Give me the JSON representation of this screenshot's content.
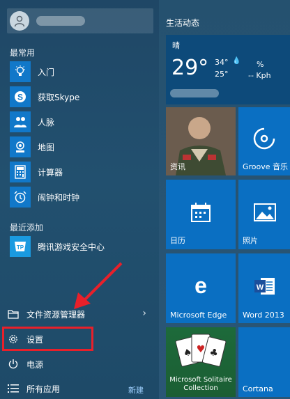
{
  "start_menu": {
    "most_used_label": "最常用",
    "most_used_apps": [
      {
        "label": "入门",
        "icon": "lightbulb-icon"
      },
      {
        "label": "获取Skype",
        "icon": "skype-icon"
      },
      {
        "label": "人脉",
        "icon": "people-icon"
      },
      {
        "label": "地图",
        "icon": "map-icon"
      },
      {
        "label": "计算器",
        "icon": "calculator-icon"
      },
      {
        "label": "闹钟和时钟",
        "icon": "alarm-clock-icon"
      }
    ],
    "recently_added_label": "最近添加",
    "recently_added_apps": [
      {
        "label": "腾讯游戏安全中心",
        "icon": "tencent-game-security-icon"
      }
    ],
    "system_items": {
      "file_explorer": "文件资源管理器",
      "settings": "设置",
      "power": "电源",
      "all_apps": "所有应用",
      "new_badge": "新建"
    }
  },
  "tiles": {
    "group_title": "生活动态",
    "weather": {
      "condition": "晴",
      "temperature": "29°",
      "high": "34°",
      "low": "25°",
      "humidity_label": "%",
      "wind_label": "-- Kph"
    },
    "news_label": "资讯",
    "groove_label": "Groove 音乐",
    "calendar_label": "日历",
    "photos_label": "照片",
    "edge_label": "Microsoft Edge",
    "word_label": "Word 2013",
    "solitaire_label": "Microsoft Solitaire Collection",
    "cortana_label": "Cortana"
  },
  "colors": {
    "tile_blue": "#0a6fc2",
    "highlight_red": "#e8202a"
  }
}
